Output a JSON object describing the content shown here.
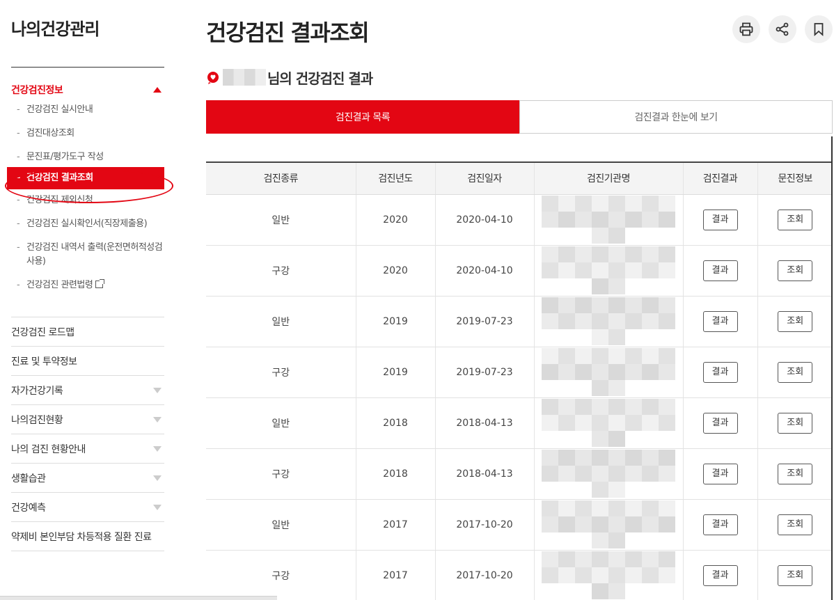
{
  "sidebar": {
    "title": "나의건강관리",
    "section_label": "건강검진정보",
    "sub_items": [
      {
        "label": "건강검진 실시안내",
        "active": false
      },
      {
        "label": "검진대상조회",
        "active": false
      },
      {
        "label": "문진표/평가도구 작성",
        "active": false
      },
      {
        "label": "건강검진 결과조회",
        "active": true
      },
      {
        "label": "건강검진 제외신청",
        "active": false
      },
      {
        "label": "건강검진 실시확인서(직장제출용)",
        "active": false
      },
      {
        "label": "건강검진 내역서 출력(운전면허적성검사용)",
        "active": false
      },
      {
        "label": "건강검진 관련법령",
        "active": false
      }
    ],
    "menu": [
      {
        "label": "건강검진 로드맵",
        "has_arrow": false
      },
      {
        "label": "진료 및 투약정보",
        "has_arrow": false
      },
      {
        "label": "자가건강기록",
        "has_arrow": true
      },
      {
        "label": "나의검진현황",
        "has_arrow": true
      },
      {
        "label": "나의 검진 현황안내",
        "has_arrow": true
      },
      {
        "label": "생활습관",
        "has_arrow": true
      },
      {
        "label": "건강예측",
        "has_arrow": true
      },
      {
        "label": "약제비 본인부담 차등적용 질환 진료",
        "has_arrow": false
      }
    ]
  },
  "page": {
    "title": "건강검진 결과조회",
    "subtitle": "님의 건강검진 결과",
    "icons": [
      "print-icon",
      "share-icon",
      "bookmark-icon"
    ]
  },
  "tabs": [
    {
      "label": "검진결과 목록",
      "active": true
    },
    {
      "label": "검진결과 한눈에 보기",
      "active": false
    }
  ],
  "table": {
    "headers": [
      "검진종류",
      "검진년도",
      "검진일자",
      "검진기관명",
      "검진결과",
      "문진정보"
    ],
    "rows": [
      {
        "type": "일반",
        "year": "2020",
        "date": "2020-04-10",
        "result_btn": "결과",
        "survey_btn": "조회"
      },
      {
        "type": "구강",
        "year": "2020",
        "date": "2020-04-10",
        "result_btn": "결과",
        "survey_btn": "조회"
      },
      {
        "type": "일반",
        "year": "2019",
        "date": "2019-07-23",
        "result_btn": "결과",
        "survey_btn": "조회"
      },
      {
        "type": "구강",
        "year": "2019",
        "date": "2019-07-23",
        "result_btn": "결과",
        "survey_btn": "조회"
      },
      {
        "type": "일반",
        "year": "2018",
        "date": "2018-04-13",
        "result_btn": "결과",
        "survey_btn": "조회"
      },
      {
        "type": "구강",
        "year": "2018",
        "date": "2018-04-13",
        "result_btn": "결과",
        "survey_btn": "조회"
      },
      {
        "type": "일반",
        "year": "2017",
        "date": "2017-10-20",
        "result_btn": "결과",
        "survey_btn": "조회"
      },
      {
        "type": "구강",
        "year": "2017",
        "date": "2017-10-20",
        "result_btn": "결과",
        "survey_btn": "조회"
      }
    ]
  },
  "colors": {
    "accent": "#e30613",
    "header_bg": "#f4f4f4"
  }
}
